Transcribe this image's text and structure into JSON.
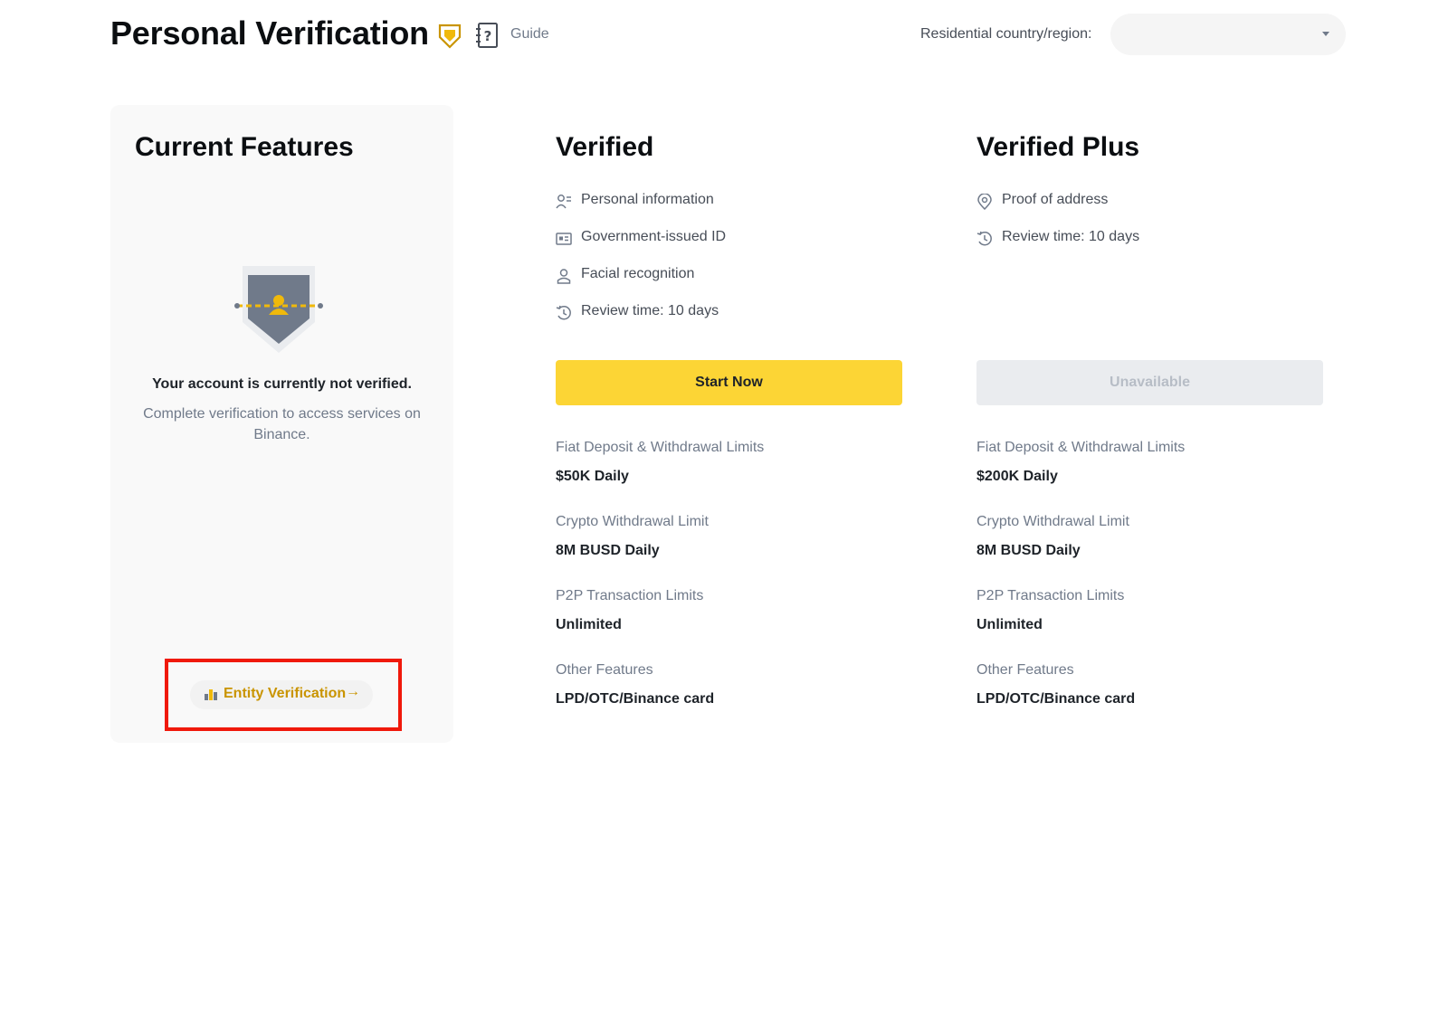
{
  "header": {
    "title": "Personal Verification",
    "guide_label": "Guide",
    "region_label": "Residential country/region:",
    "region_value": ""
  },
  "current": {
    "title": "Current Features",
    "status_title": "Your account is currently not verified.",
    "status_desc": "Complete verification to access services on Binance.",
    "entity_label": "Entity Verification",
    "entity_arrow": "→"
  },
  "verified": {
    "title": "Verified",
    "requirements": [
      {
        "icon": "personal-info-icon",
        "label": "Personal information"
      },
      {
        "icon": "id-card-icon",
        "label": "Government-issued ID"
      },
      {
        "icon": "person-icon",
        "label": "Facial recognition"
      },
      {
        "icon": "clock-history-icon",
        "label": "Review time: 10 days"
      }
    ],
    "button_label": "Start Now",
    "limits": [
      {
        "label": "Fiat Deposit & Withdrawal Limits",
        "value": "$50K Daily"
      },
      {
        "label": "Crypto Withdrawal Limit",
        "value": "8M BUSD Daily"
      },
      {
        "label": "P2P Transaction Limits",
        "value": "Unlimited"
      },
      {
        "label": "Other Features",
        "value": "LPD/OTC/Binance card"
      }
    ]
  },
  "verified_plus": {
    "title": "Verified Plus",
    "requirements": [
      {
        "icon": "location-pin-icon",
        "label": "Proof of address"
      },
      {
        "icon": "clock-history-icon",
        "label": "Review time: 10 days"
      }
    ],
    "button_label": "Unavailable",
    "limits": [
      {
        "label": "Fiat Deposit & Withdrawal Limits",
        "value": "$200K Daily"
      },
      {
        "label": "Crypto Withdrawal Limit",
        "value": "8M BUSD Daily"
      },
      {
        "label": "P2P Transaction Limits",
        "value": "Unlimited"
      },
      {
        "label": "Other Features",
        "value": "LPD/OTC/Binance card"
      }
    ]
  },
  "colors": {
    "accent": "#fcd535",
    "accent_text": "#c99400",
    "highlight": "#f0190b"
  }
}
